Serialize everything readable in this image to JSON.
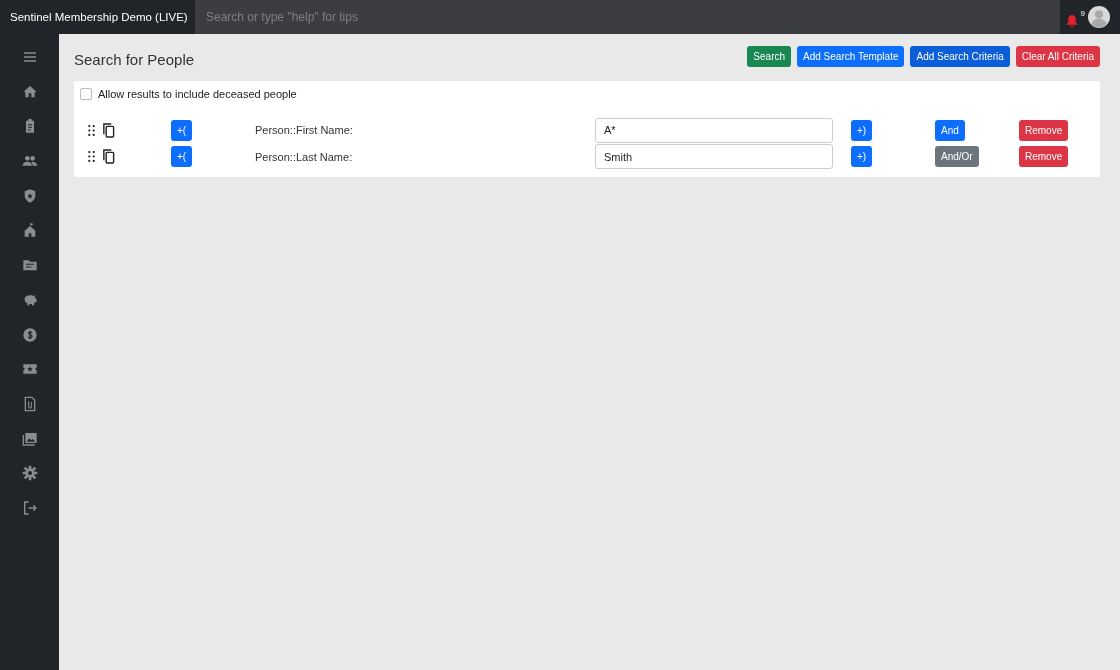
{
  "topbar": {
    "brand": "Sentinel Membership Demo (LIVE)",
    "search": {
      "placeholder": "Search or type \"help\" for tips"
    },
    "notifications": {
      "count": "9"
    }
  },
  "page": {
    "title": "Search for People"
  },
  "actions": [
    {
      "label": "Search",
      "kind": "success"
    },
    {
      "label": "Add Search Template",
      "kind": "primary"
    },
    {
      "label": "Add Search Criteria",
      "kind": "darkprimary"
    },
    {
      "label": "Clear All Criteria",
      "kind": "danger"
    }
  ],
  "deceased": {
    "label": "Allow results to include deceased people",
    "checked": false
  },
  "criteria": [
    {
      "open_paren": "+(",
      "field": "Person::First Name:",
      "value": "A*",
      "close_paren": "+)",
      "connector": {
        "label": "And",
        "kind": "primary"
      },
      "remove": "Remove"
    },
    {
      "open_paren": "+(",
      "field": "Person::Last Name:",
      "value": "Smith",
      "close_paren": "+)",
      "connector": {
        "label": "And/Or",
        "kind": "secondary"
      },
      "remove": "Remove"
    }
  ]
}
